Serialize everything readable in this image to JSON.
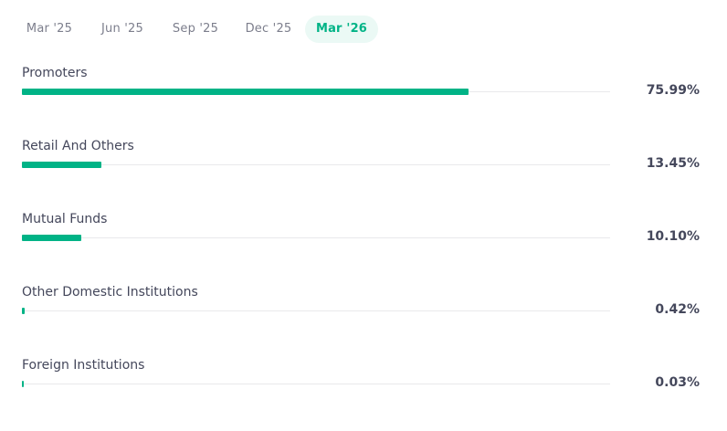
{
  "tabs": [
    {
      "label": "Mar '25",
      "active": false
    },
    {
      "label": "Jun '25",
      "active": false
    },
    {
      "label": "Sep '25",
      "active": false
    },
    {
      "label": "Dec '25",
      "active": false
    },
    {
      "label": "Mar '26",
      "active": true
    }
  ],
  "holdings": [
    {
      "name": "Promoters",
      "value": 75.99,
      "display": "75.99%"
    },
    {
      "name": "Retail And Others",
      "value": 13.45,
      "display": "13.45%"
    },
    {
      "name": "Mutual Funds",
      "value": 10.1,
      "display": "10.10%"
    },
    {
      "name": "Other Domestic Institutions",
      "value": 0.42,
      "display": "0.42%"
    },
    {
      "name": "Foreign Institutions",
      "value": 0.03,
      "display": "0.03%"
    }
  ],
  "colors": {
    "accent": "#00b386",
    "accent_bg": "#ebf9f5",
    "track": "#e9e9eb",
    "text": "#44475b",
    "muted": "#7c7e8c"
  }
}
